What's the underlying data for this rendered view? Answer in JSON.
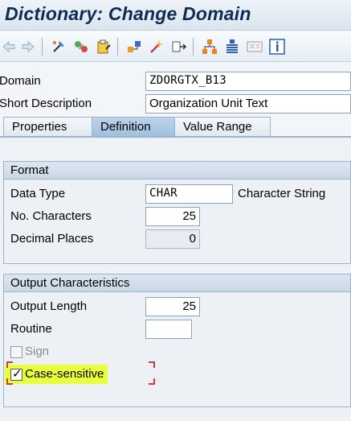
{
  "window": {
    "title": "Dictionary: Change Domain"
  },
  "toolbar": {
    "icons": [
      "back-arrow-icon",
      "forward-arrow-icon",
      "other-object-icon",
      "display-change-icon",
      "activate-icon",
      "where-used-icon",
      "object-list-icon",
      "navigation-window-icon",
      "hierarchy-icon",
      "tree-list-icon",
      "screen-icon",
      "info-icon"
    ]
  },
  "header": {
    "domain_label": "Domain",
    "domain_value": "ZDORGTX_B13",
    "short_desc_label": "Short Description",
    "short_desc_value": "Organization Unit Text"
  },
  "tabs": [
    {
      "label": "Properties",
      "active": false
    },
    {
      "label": "Definition",
      "active": true
    },
    {
      "label": "Value Range",
      "active": false
    }
  ],
  "format": {
    "title": "Format",
    "data_type_label": "Data Type",
    "data_type_value": "CHAR",
    "data_type_desc": "Character String",
    "no_chars_label": "No. Characters",
    "no_chars_value": "25",
    "decimals_label": "Decimal Places",
    "decimals_value": "0"
  },
  "output": {
    "title": "Output Characteristics",
    "length_label": "Output Length",
    "length_value": "25",
    "routine_label": "Routine",
    "routine_value": "",
    "sign_label": "Sign",
    "sign_checked": false,
    "case_label": "Case-sensitive",
    "case_checked": true
  },
  "colors": {
    "title": "#0d2b55",
    "highlight": "#e9ff3a",
    "focus_bracket": "#d53a3a"
  }
}
